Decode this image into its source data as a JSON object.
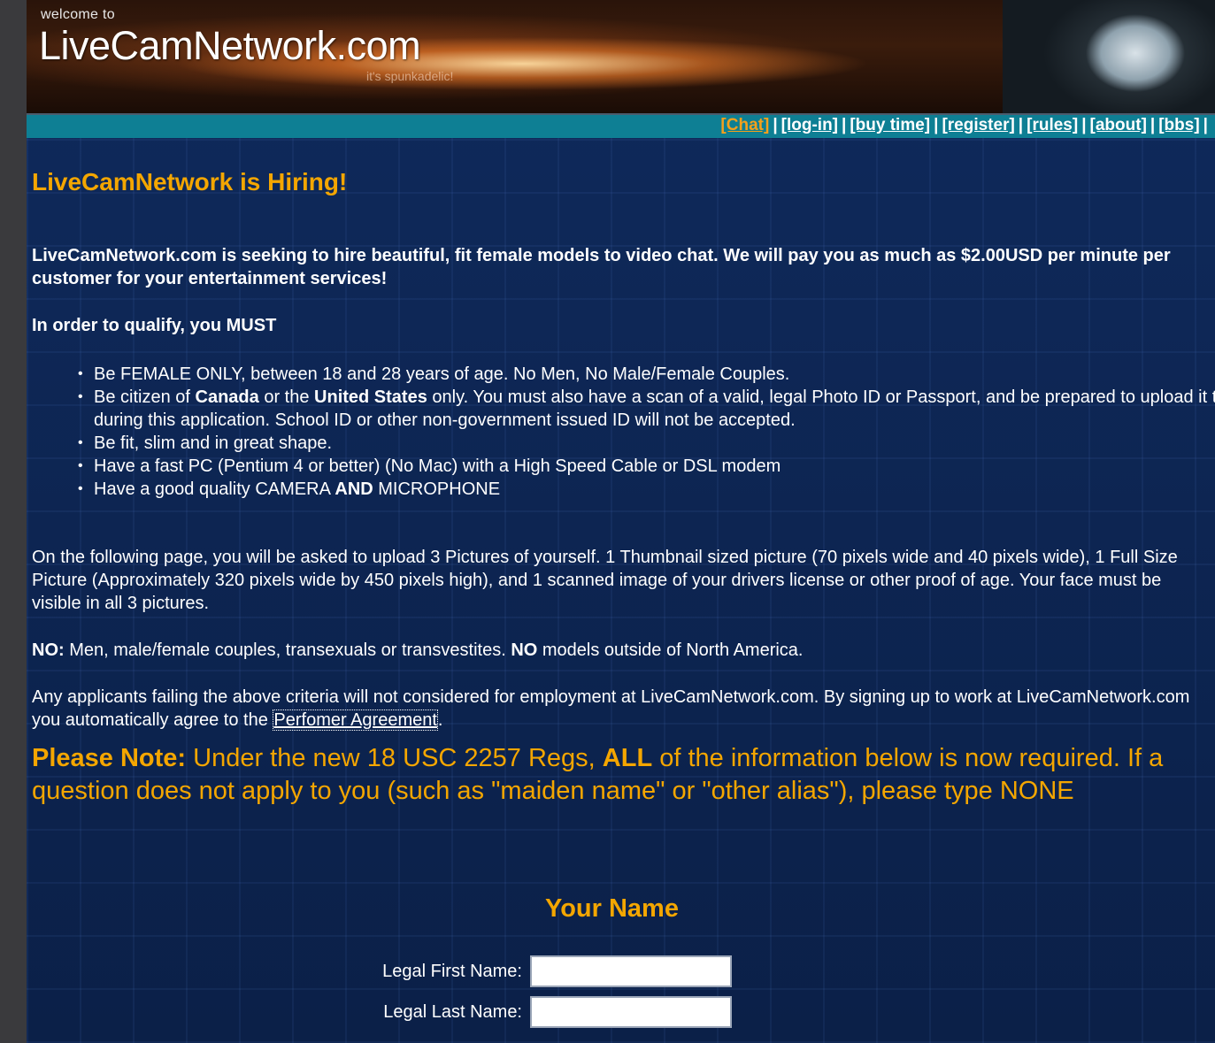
{
  "header": {
    "welcome": "welcome to",
    "site_name": "LiveCamNetwork.com",
    "tagline": "it's spunkadelic!"
  },
  "nav": {
    "items": [
      "[Chat]",
      "[log-in]",
      "[buy time]",
      "[register]",
      "[rules]",
      "[about]",
      "[bbs]"
    ],
    "separator": "|",
    "active": "[Chat]"
  },
  "main": {
    "heading": "LiveCamNetwork is Hiring!",
    "intro": "LiveCamNetwork.com is seeking to hire beautiful, fit female models to video chat. We will pay you as much as $2.00USD per minute per customer for your entertainment services!",
    "qualify": "In order to qualify, you MUST",
    "requirements": {
      "r1": "Be FEMALE ONLY, between 18 and 28 years of age. No Men, No Male/Female Couples.",
      "r2_a": "Be citizen of ",
      "r2_canada": "Canada",
      "r2_b": " or the ",
      "r2_us": "United States",
      "r2_c": " only. You must also have a scan of a valid, legal Photo ID or Passport, and be prepared to upload it to us during this application. School ID or other non-government issued ID will not be accepted.",
      "r3": "Be fit, slim and in great shape.",
      "r4": "Have a fast PC (Pentium 4 or better) (No Mac) with a High Speed Cable or DSL modem",
      "r5_a": "Have a good quality CAMERA ",
      "r5_and": "AND",
      "r5_b": " MICROPHONE"
    },
    "pictures": "On the following page, you will be asked to upload 3 Pictures of yourself. 1 Thumbnail sized picture (70 pixels wide and 40 pixels wide), 1 Full Size Picture (Approximately 320 pixels wide by 450 pixels high), and 1 scanned image of your drivers license or other proof of age. Your face must be visible in all 3 pictures.",
    "no_a": "NO:",
    "no_b": " Men, male/female couples, transexuals or transvestites. ",
    "no_c": "NO",
    "no_d": " models outside of North America.",
    "criteria_a": "Any applicants failing the above criteria will not considered for employment at LiveCamNetwork.com. By signing up to work at LiveCamNetwork.com you automatically agree to the ",
    "criteria_link": "Perfomer Agreement",
    "criteria_b": ".",
    "note_a": "Please Note:",
    "note_b": " Under the new 18 USC 2257 Regs, ",
    "note_all": "ALL",
    "note_c": " of the information below is now required. If a question does not apply to you (such as \"maiden name\" or \"other alias\"), please type NONE"
  },
  "form": {
    "title": "Your Name",
    "first_label": "Legal First Name:",
    "first_value": "",
    "last_label": "Legal Last Name:",
    "last_value": ""
  },
  "colors": {
    "accent": "#f4a600",
    "background": "#0d2450",
    "navbar": "#0e7f94"
  }
}
